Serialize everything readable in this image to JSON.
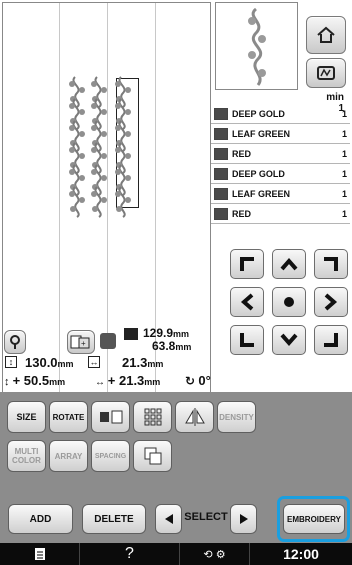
{
  "toolbar_right": {
    "home_icon": "home-icon",
    "frame_icon": "embroidery-frame-icon"
  },
  "thread_time": {
    "label": "min",
    "value": "1"
  },
  "colors": [
    {
      "name": "DEEP GOLD",
      "count": "1",
      "color": "#4a4a4a"
    },
    {
      "name": "LEAF GREEN",
      "count": "1",
      "color": "#4a4a4a"
    },
    {
      "name": "RED",
      "count": "1",
      "color": "#4a4a4a"
    },
    {
      "name": "DEEP GOLD",
      "count": "1",
      "color": "#4a4a4a"
    },
    {
      "name": "LEAF GREEN",
      "count": "1",
      "color": "#4a4a4a"
    },
    {
      "name": "RED",
      "count": "1",
      "color": "#4a4a4a"
    }
  ],
  "size_info": {
    "pattern_height": "129.9",
    "pattern_width": "63.8",
    "unit": "mm",
    "vertical": "130.0",
    "horizontal": "21.3",
    "offset_v": "+ 50.5",
    "offset_h": "+ 21.3",
    "angle": "0°"
  },
  "tools": {
    "size": "SIZE",
    "rotate": "ROTATE",
    "density": "DENSITY",
    "multi_color": "MULTI\nCOLOR",
    "array": "ARRAY",
    "spacing": "SPACING"
  },
  "actions": {
    "add": "ADD",
    "delete": "DELETE",
    "select": "SELECT",
    "embroidery": "EMBROIDERY"
  },
  "status_bar": {
    "time": "12:00",
    "help": "?"
  }
}
